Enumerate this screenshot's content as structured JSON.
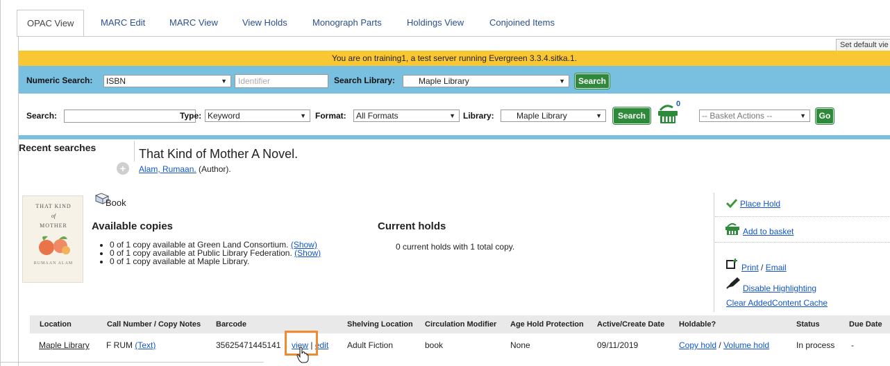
{
  "tabs": [
    "OPAC View",
    "MARC Edit",
    "MARC View",
    "View Holds",
    "Monograph Parts",
    "Holdings View",
    "Conjoined Items"
  ],
  "set_default_label": "Set default vie",
  "banner_text": "You are on training1, a test server running Evergreen 3.3.4.sitka.1.",
  "numeric_search": {
    "label": "Numeric Search:",
    "selected": "ISBN",
    "identifier_placeholder": "Identifier",
    "library_label": "Search Library:",
    "library_selected": "Maple Library",
    "button": "Search"
  },
  "search_bar": {
    "search_label": "Search:",
    "type_label": "Type:",
    "type_selected": "Keyword",
    "format_label": "Format:",
    "format_selected": "All Formats",
    "library_label": "Library:",
    "library_selected": "Maple Library",
    "button": "Search",
    "basket_count": "0",
    "basket_actions": "-- Basket Actions --",
    "go_button": "Go"
  },
  "recent_searches_label": "Recent searches",
  "record": {
    "title": "That Kind of Mother A Novel.",
    "author_link": "Alam, Rumaan.",
    "author_role": "(Author).",
    "format": "Book",
    "cover": {
      "line1": "THAT KIND",
      "line2": "of",
      "line3": "MOTHER",
      "line4": "RUMAAN ALAM"
    }
  },
  "available_copies": {
    "heading": "Available copies",
    "items": [
      {
        "text": "0 of 1 copy available at Green Land Consortium.",
        "link": "(Show)"
      },
      {
        "text": "0 of 1 copy available at Public Library Federation.",
        "link": "(Show)"
      },
      {
        "text": "0 of 1 copy available at Maple Library.",
        "link": ""
      }
    ]
  },
  "current_holds": {
    "heading": "Current holds",
    "text": "0 current holds with 1 total copy."
  },
  "actions": {
    "place_hold": "Place Hold",
    "add_to_basket": "Add to basket",
    "print": "Print",
    "sep": " / ",
    "email": "Email",
    "disable_highlighting": "Disable Highlighting",
    "clear_cache": "Clear AddedContent Cache"
  },
  "holdings_table": {
    "headers": [
      "Location",
      "Call Number / Copy Notes",
      "Barcode",
      "Shelving Location",
      "Circulation Modifier",
      "Age Hold Protection",
      "Active/Create Date",
      "Holdable?",
      "Status",
      "Due Date"
    ],
    "row": {
      "location": "Maple Library",
      "call_number": "F RUM",
      "call_note_link": "(Text)",
      "barcode": "35625471445141",
      "view_link": "view",
      "bar_sep": " | ",
      "edit_link": "edit",
      "shelving_location": "Adult Fiction",
      "circ_modifier": "book",
      "age_hold": "None",
      "create_date": "09/11/2019",
      "copy_hold": "Copy hold",
      "hold_sep": " / ",
      "volume_hold": "Volume hold",
      "status": "In process",
      "due_date": "-"
    }
  },
  "colors": {
    "banner": "#f9c634",
    "search_bar": "#78bfe0",
    "button_green": "#2e8a3a",
    "link": "#1155cc",
    "highlight": "#ef8a2e"
  }
}
